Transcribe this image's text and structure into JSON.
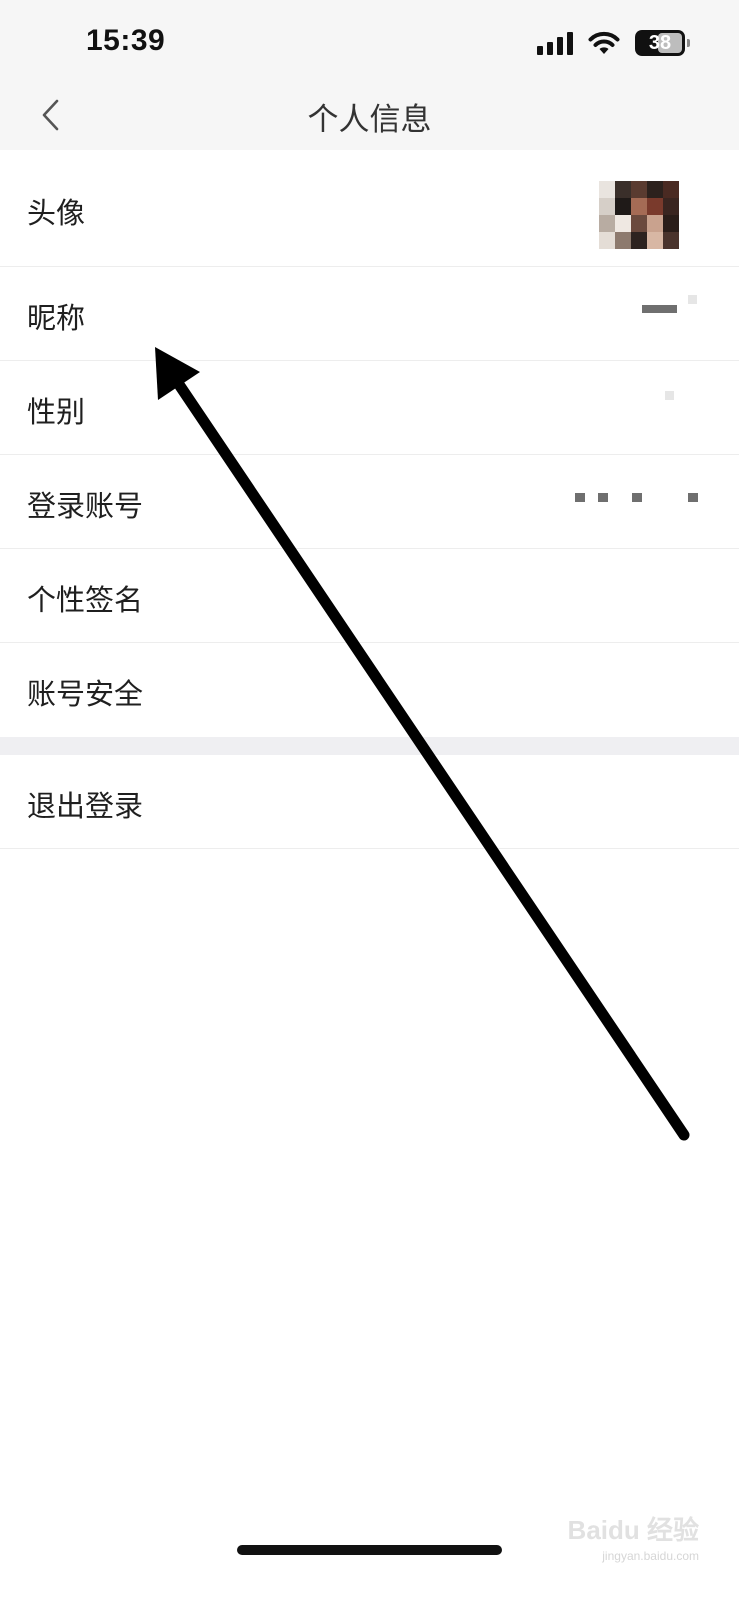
{
  "status_bar": {
    "time": "15:39",
    "battery_level": "38",
    "icons": [
      "signal-icon",
      "wifi-icon",
      "battery-icon"
    ]
  },
  "nav": {
    "back_icon": "chevron-left-icon",
    "title": "个人信息"
  },
  "items": [
    {
      "label": "头像",
      "value_type": "avatar-image"
    },
    {
      "label": "昵称",
      "value_type": "redacted"
    },
    {
      "label": "性别",
      "value_type": "redacted"
    },
    {
      "label": "登录账号",
      "value_type": "redacted"
    },
    {
      "label": "个性签名",
      "value_type": "empty"
    },
    {
      "label": "账号安全",
      "value_type": "empty"
    }
  ],
  "logout": {
    "label": "退出登录"
  },
  "annotation": {
    "type": "arrow",
    "color": "#000000",
    "points_to": "昵称"
  },
  "watermark": {
    "main": "Baidu 经验",
    "sub": "jingyan.baidu.com"
  },
  "colors": {
    "header_bg": "#f6f6f6",
    "section_gap": "#efeff2",
    "divider": "#ededed",
    "text": "#1f1f1f"
  }
}
